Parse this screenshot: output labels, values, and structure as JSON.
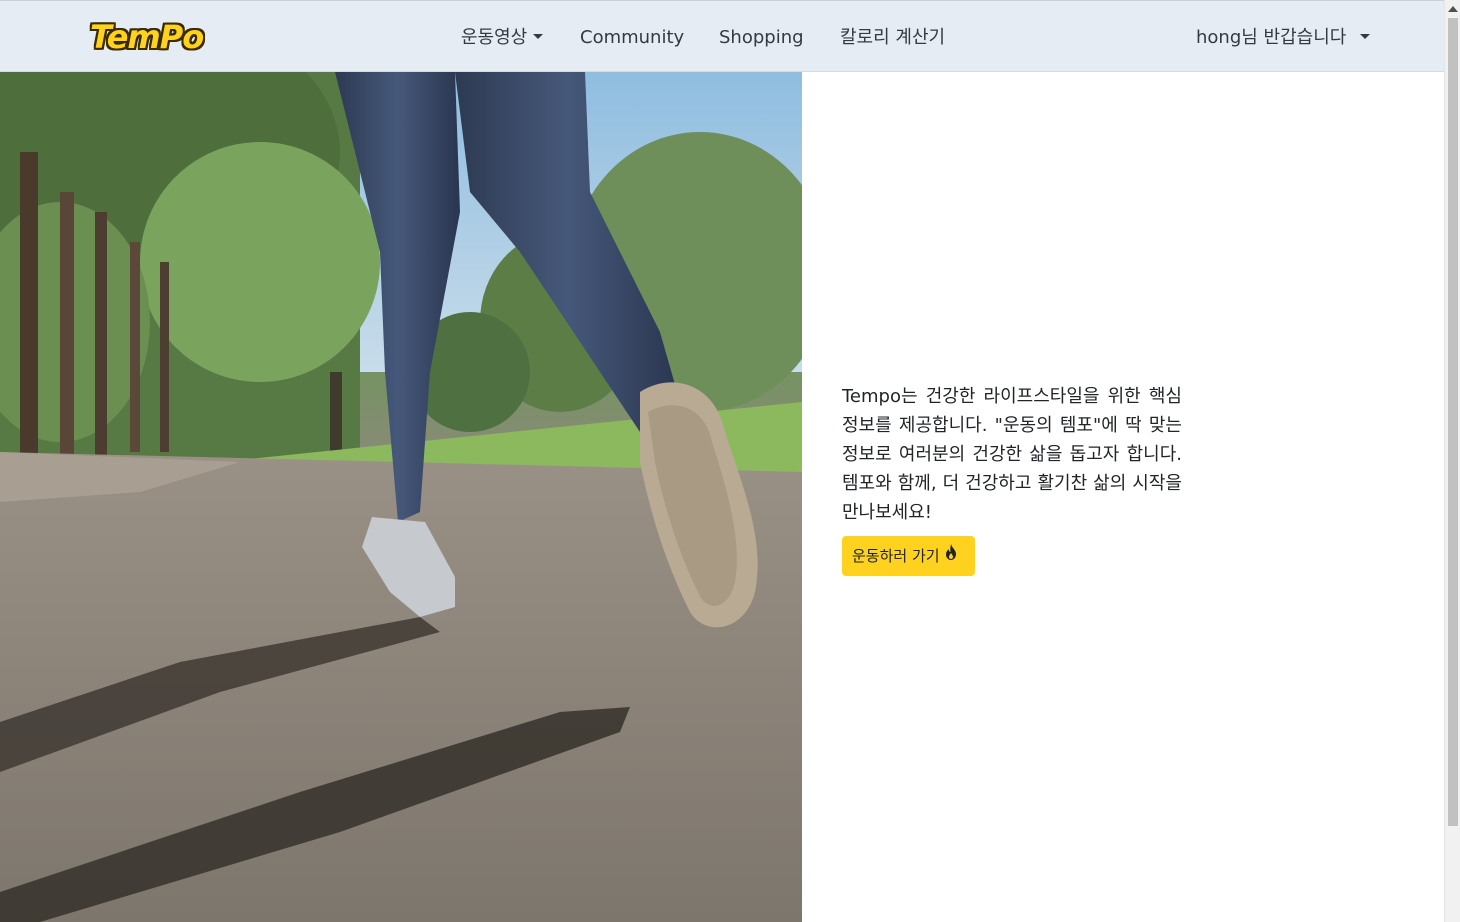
{
  "navbar": {
    "logo_text": "TemPo",
    "items": [
      {
        "label": "운동영상",
        "has_dropdown": true
      },
      {
        "label": "Community",
        "has_dropdown": false
      },
      {
        "label": "Shopping",
        "has_dropdown": false
      },
      {
        "label": "칼로리 계산기",
        "has_dropdown": false
      }
    ],
    "user_menu_label": "hong님 반갑습니다",
    "colors": {
      "background": "#e6ecf3",
      "logo": "#ffd21f"
    }
  },
  "hero": {
    "image_icon": "runner-photo-icon",
    "description": "Tempo는 건강한 라이프스타일을 위한 핵심 정보를 제공합니다. \"운동의 템포\"에 딱 맞는 정보로 여러분의 건강한 삶을 돕고자 합니다. 템포와 함께, 더 건강하고 활기찬 삶의 시작을 만나보세요!",
    "cta_label": "운동하러 가기",
    "cta_icon": "fire-icon",
    "cta_color": "#ffd21f"
  }
}
